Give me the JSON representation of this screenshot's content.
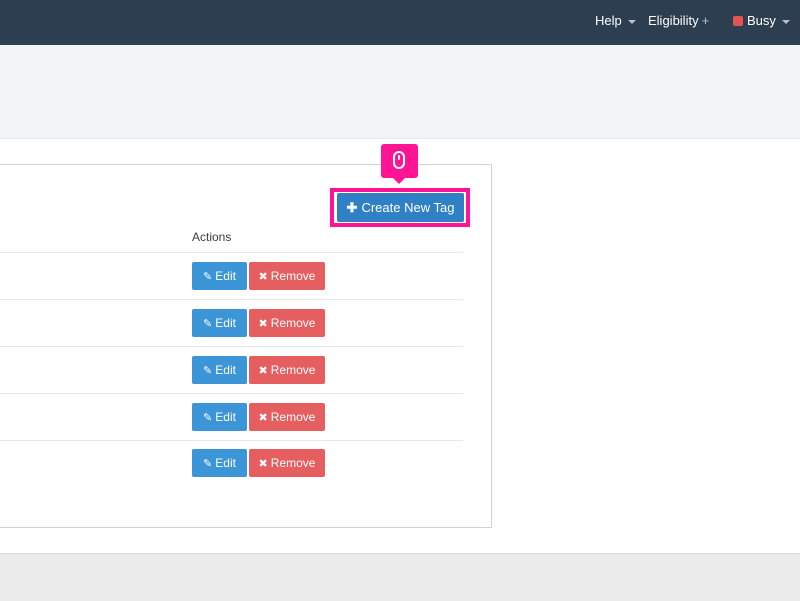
{
  "topbar": {
    "help_label": "Help",
    "eligibility_label": "Eligibility",
    "eligibility_suffix": "+",
    "status_label": "Busy",
    "status_color": "#e55353"
  },
  "panel": {
    "create_button_label": "Create New Tag",
    "create_button_icon": "plus-icon",
    "actions_header": "Actions",
    "rows": [
      {
        "edit_label": "Edit",
        "remove_label": "Remove"
      },
      {
        "edit_label": "Edit",
        "remove_label": "Remove"
      },
      {
        "edit_label": "Edit",
        "remove_label": "Remove"
      },
      {
        "edit_label": "Edit",
        "remove_label": "Remove"
      },
      {
        "edit_label": "Edit",
        "remove_label": "Remove"
      }
    ]
  },
  "annotation": {
    "cursor_icon": "mouse-icon",
    "highlight_color": "#ff1493"
  },
  "colors": {
    "topbar": "#2c3e50",
    "primary": "#2f80c4",
    "edit": "#3c95d6",
    "danger": "#e55e60"
  }
}
